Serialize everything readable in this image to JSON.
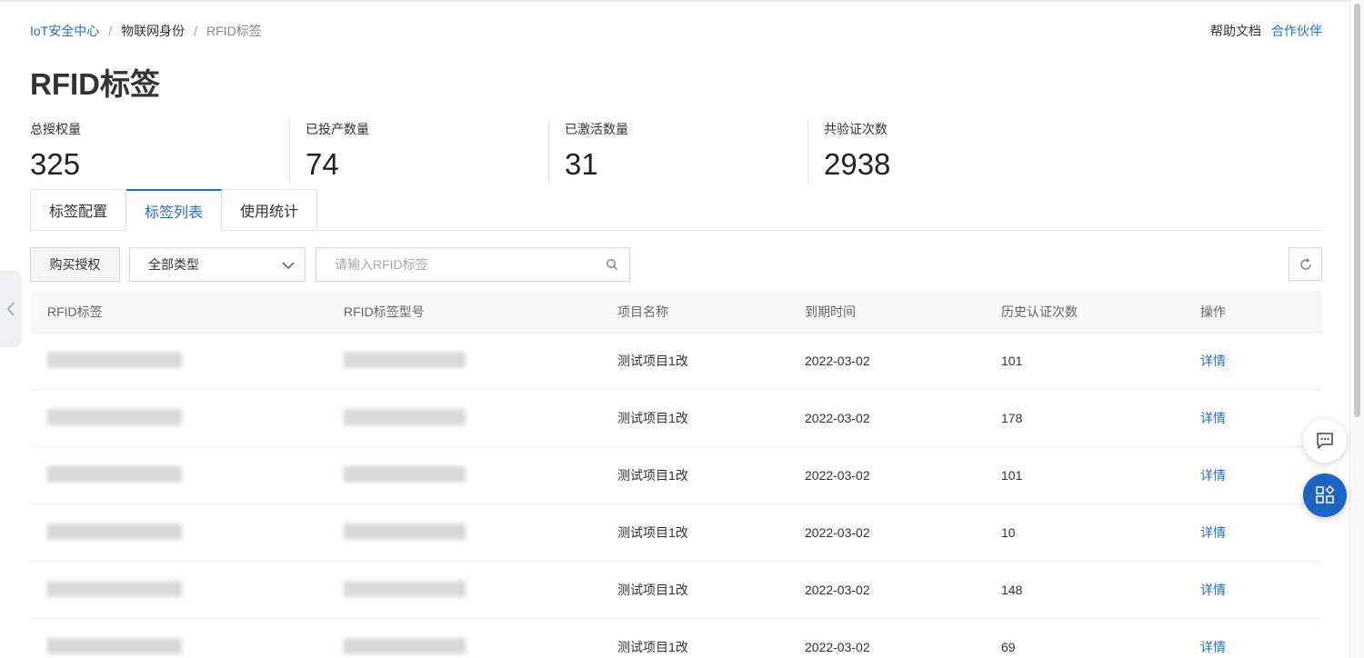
{
  "breadcrumb": {
    "items": [
      "IoT安全中心",
      "物联网身份",
      "RFID标签"
    ],
    "separator": "/"
  },
  "header": {
    "help_label": "帮助文档",
    "partner_label": "合作伙伴"
  },
  "page_title": "RFID标签",
  "stats": [
    {
      "label": "总授权量",
      "value": "325"
    },
    {
      "label": "已投产数量",
      "value": "74"
    },
    {
      "label": "已激活数量",
      "value": "31"
    },
    {
      "label": "共验证次数",
      "value": "2938"
    }
  ],
  "tabs": [
    {
      "label": "标签配置",
      "active": false
    },
    {
      "label": "标签列表",
      "active": true
    },
    {
      "label": "使用统计",
      "active": false
    }
  ],
  "toolbar": {
    "buy_label": "购买授权",
    "type_select_value": "全部类型",
    "search_placeholder": "请输入RFID标签"
  },
  "table": {
    "columns": [
      "RFID标签",
      "RFID标签型号",
      "项目名称",
      "到期时间",
      "历史认证次数",
      "操作"
    ],
    "rows": [
      {
        "project": "测试项目1改",
        "expire": "2022-03-02",
        "count": "101",
        "action": "详情"
      },
      {
        "project": "测试项目1改",
        "expire": "2022-03-02",
        "count": "178",
        "action": "详情"
      },
      {
        "project": "测试项目1改",
        "expire": "2022-03-02",
        "count": "101",
        "action": "详情"
      },
      {
        "project": "测试项目1改",
        "expire": "2022-03-02",
        "count": "10",
        "action": "详情"
      },
      {
        "project": "测试项目1改",
        "expire": "2022-03-02",
        "count": "148",
        "action": "详情"
      },
      {
        "project": "测试项目1改",
        "expire": "2022-03-02",
        "count": "69",
        "action": "详情"
      }
    ]
  },
  "colors": {
    "accent": "#1f6fd1",
    "fab_blue": "#1e62c4",
    "header_bg": "#f7f8fa",
    "border": "#e3e3e3"
  },
  "icons": [
    "chevron-left-icon",
    "chevron-down-icon",
    "search-icon",
    "refresh-icon",
    "chat-icon",
    "apps-icon"
  ]
}
